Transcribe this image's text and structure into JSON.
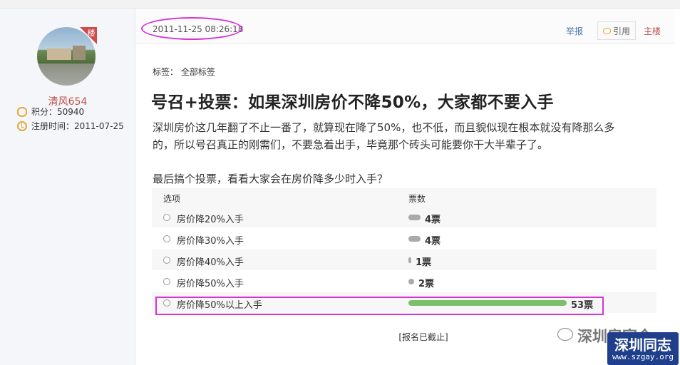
{
  "header": {
    "post_time": "2011-11-25 08:26:18",
    "report_label": "举报",
    "quote_label": "引用",
    "owner_label": "主楼"
  },
  "user": {
    "floor_badge": "楼",
    "name": "清风654",
    "points": "积分：50940",
    "register": "注册时间：2011-07-25"
  },
  "post": {
    "tags": "标签：  全部标签",
    "title": "号召+投票：如果深圳房价不降50%，大家都不要入手",
    "body_line1": "深圳房价这几年翻了不止一番了，就算现在降了50%，也不低，而且貌似现在根本就没有降那么多",
    "body_line2": "的，所以号召真正的刚需们，不要急着出手，毕竟那个砖头可能要你干大半辈子了。",
    "poll_intro": "最后搞个投票，看看大家会在房价降多少时入手？"
  },
  "poll": {
    "col_option": "选项",
    "col_votes": "票数",
    "max_votes": 53,
    "options": [
      {
        "label": "房价降20%入手",
        "votes": 4,
        "votes_label": "4票"
      },
      {
        "label": "房价降30%入手",
        "votes": 4,
        "votes_label": "4票"
      },
      {
        "label": "房价降40%入手",
        "votes": 1,
        "votes_label": "1票"
      },
      {
        "label": "房价降50%入手",
        "votes": 2,
        "votes_label": "2票"
      },
      {
        "label": "房价降50%以上入手",
        "votes": 53,
        "votes_label": "53票"
      }
    ],
    "closed_label": "[报名已截止]"
  },
  "watermark": {
    "text": "深圳房官会",
    "logo_main": "深圳同志",
    "logo_url": "www.szgay.org"
  }
}
